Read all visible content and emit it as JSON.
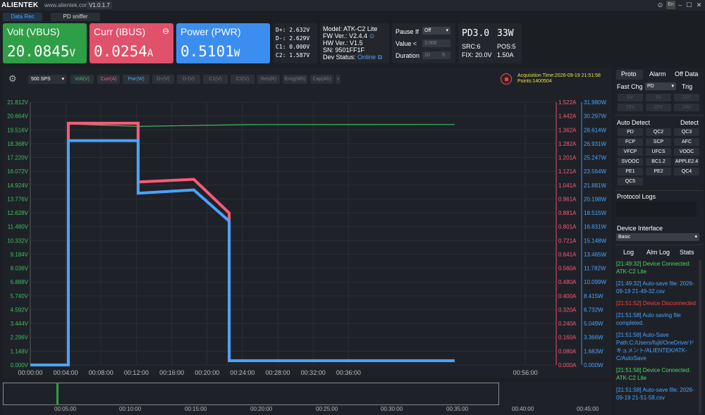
{
  "app": {
    "brand": "ALIENTEK",
    "url": "www.alientek.com",
    "version": "V1.0.1.7"
  },
  "window_buttons": {
    "pin": "⊙",
    "lang": "En",
    "min": "–",
    "max": "☐",
    "close": "✕"
  },
  "tabs": [
    {
      "label": "Data Rec",
      "active": true
    },
    {
      "label": "PD sniffer",
      "active": false
    }
  ],
  "meters": {
    "volt": {
      "label": "Volt (VBUS)",
      "value": "20.0845",
      "unit": "V",
      "color": "#2e9e47"
    },
    "curr": {
      "label": "Curr (IBUS)",
      "value": "0.0254",
      "unit": "A",
      "color": "#e0516b",
      "icon": "⊖"
    },
    "pwr": {
      "label": "Power (PWR)",
      "value": "0.5101",
      "unit": "W",
      "color": "#3b8ef0"
    }
  },
  "dlines": [
    {
      "label": "D+:",
      "value": "2.632",
      "unit": "V"
    },
    {
      "label": "D-:",
      "value": "2.629",
      "unit": "V"
    },
    {
      "label": "C1:",
      "value": "0.000",
      "unit": "V"
    },
    {
      "label": "C2:",
      "value": "1.587",
      "unit": "V"
    }
  ],
  "device": {
    "model_label": "Model:",
    "model": "ATK-C2 Lite",
    "fw_label": "FW Ver.:",
    "fw": "V2.4.4",
    "hw_label": "HW Ver.:",
    "hw": "V1.5",
    "sn_label": "SN:",
    "sn": "9501FF1F",
    "status_label": "Dev Status:",
    "status": "Online"
  },
  "pause": {
    "label": "Pause If",
    "option": "Off",
    "value_label": "Value <",
    "value": "3.000",
    "duration_label": "Duration",
    "duration": "10",
    "duration2": "5"
  },
  "pd": {
    "protocol": "PD3.0",
    "power": "33W",
    "src": "SRC:6",
    "pos": "POS:5",
    "fix": "FIX: 20.0V",
    "amp": "1.50A"
  },
  "toolbar": {
    "sps": "500 SPS",
    "buttons": [
      {
        "label": "Volt(V)",
        "color": "#3fbf5f"
      },
      {
        "label": "Curr(A)",
        "color": "#ff5a78"
      },
      {
        "label": "Pwr(W)",
        "color": "#4aa3ff"
      },
      {
        "label": "D+(V)",
        "color": "#777"
      },
      {
        "label": "D-(V)",
        "color": "#777"
      },
      {
        "label": "C1(V)",
        "color": "#777"
      },
      {
        "label": "C2(V)",
        "color": "#777"
      },
      {
        "label": "Res(R)",
        "color": "#777"
      },
      {
        "label": "Enrg(Wh)",
        "color": "#777"
      },
      {
        "label": "Cap(Ah)",
        "color": "#777"
      }
    ]
  },
  "acquisition": {
    "time": "Acquisition Time:2026-09-19 21:51:58",
    "points": "Points:1400504"
  },
  "chart_data": {
    "type": "line",
    "x_ticks": [
      "00:00:00",
      "00:04:00",
      "00:08:00",
      "00:12:00",
      "00:16:00",
      "00:20:00",
      "00:24:00",
      "00:28:00",
      "00:32:00",
      "00:36:00",
      "00:56:00"
    ],
    "y_volt_ticks": [
      "21.812V",
      "20.664V",
      "19.516V",
      "18.368V",
      "17.220V",
      "16.072V",
      "14.924V",
      "13.776V",
      "12.628V",
      "11.480V",
      "10.332V",
      "9.184V",
      "8.036V",
      "6.888V",
      "5.740V",
      "4.592V",
      "3.444V",
      "2.296V",
      "1.148V",
      "0.000V"
    ],
    "y_curr_ticks": [
      "1.522A",
      "1.442A",
      "1.362A",
      "1.282A",
      "1.201A",
      "1.121A",
      "1.041A",
      "0.961A",
      "0.881A",
      "0.801A",
      "0.721A",
      "0.641A",
      "0.560A",
      "0.480A",
      "0.400A",
      "0.320A",
      "0.240A",
      "0.160A",
      "0.080A",
      "0.000A"
    ],
    "y_pwr_ticks": [
      "31.980W",
      "30.297W",
      "28.614W",
      "26.931W",
      "25.247W",
      "23.564W",
      "21.881W",
      "20.198W",
      "18.515W",
      "16.831W",
      "15.148W",
      "13.465W",
      "11.782W",
      "10.099W",
      "8.415W",
      "6.732W",
      "5.049W",
      "3.366W",
      "1.683W",
      "0.000W"
    ],
    "series": [
      {
        "name": "Volt(V)",
        "color": "#3fbf5f",
        "x_min": [
          0,
          4.3,
          4.3,
          12.2,
          24.5,
          48
        ],
        "y": [
          0,
          0,
          20.0,
          19.8,
          19.95,
          19.96
        ]
      },
      {
        "name": "Curr(A)",
        "color": "#ff5a78",
        "x_min": [
          0,
          4.3,
          4.3,
          12.2,
          12.2,
          18.5,
          22.5,
          22.5,
          48
        ],
        "y": [
          0,
          0,
          1.4,
          1.4,
          1.06,
          1.075,
          0.88,
          0.025,
          0.025
        ]
      },
      {
        "name": "Pwr(W)",
        "color": "#4aa3ff",
        "x_min": [
          0,
          4.3,
          4.3,
          12.2,
          12.2,
          18.5,
          22.5,
          22.5,
          48
        ],
        "y": [
          0,
          0,
          27.3,
          27.3,
          20.9,
          21.3,
          17.5,
          0.51,
          0.51
        ]
      }
    ]
  },
  "overview": {
    "ticks": [
      "00:05:00",
      "00:10:00",
      "00:15:00",
      "00:20:00",
      "00:25:00",
      "00:30:00",
      "00:35:00",
      "00:40:00",
      "00:45:00"
    ]
  },
  "right": {
    "tabs": [
      "Proto",
      "Alarm",
      "Off Data"
    ],
    "fast_chg_label": "Fast Chg",
    "fast_chg_value": "PD",
    "trig_label": "Trig",
    "volts": [
      "5V",
      "9V",
      "12V",
      "15V",
      "20V",
      "24V"
    ],
    "auto_detect": "Auto Detect",
    "detect": "Detect",
    "protocols": [
      "PD",
      "QC2",
      "QC3",
      "FCP",
      "SCP",
      "AFC",
      "VFCP",
      "UFCS",
      "VOOC",
      "SVOOC",
      "BC1.2",
      "APPLE2.4",
      "PE1",
      "PE2",
      "QC4",
      "QC5"
    ],
    "protocol_logs": "Protocol Logs",
    "device_interface": "Device Interface",
    "interface_value": "Basic",
    "log_tabs": [
      "Log",
      "Alm Log",
      "Stats"
    ],
    "logs": [
      {
        "text": "[21:49:32] Device Connected: ATK-C2 Lite",
        "color": "#4cd964"
      },
      {
        "text": "[21:49:32] Auto-save file: 2026-09-19 21-49-32.csv",
        "color": "#4aa3ff"
      },
      {
        "text": "[21:51:52] Device Disconnected",
        "color": "#ff4040"
      },
      {
        "text": "[21:51:58] Auto saving file completed.",
        "color": "#4aa3ff"
      },
      {
        "text": "[21:51:58] Auto-Save Path:C:/Users/fujit/OneDrive/ドキュメント/ALIENTEK/ATK-C/AutoSave",
        "color": "#4aa3ff"
      },
      {
        "text": "[21:51:58] Device Connected: ATK-C2 Lite",
        "color": "#4cd964"
      },
      {
        "text": "[21:51:58] Auto-save file: 2026-09-19 21-51-58.csv",
        "color": "#4aa3ff"
      }
    ]
  }
}
